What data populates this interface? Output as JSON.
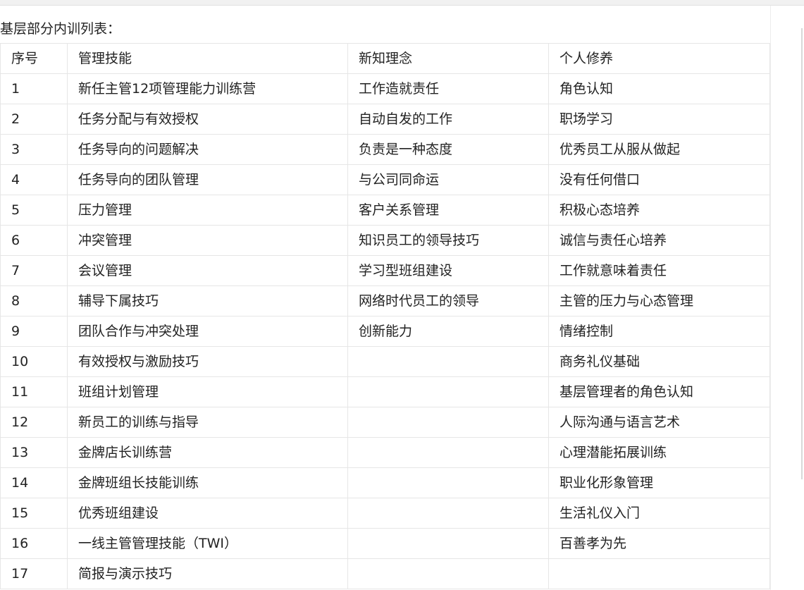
{
  "page_title": "基层部分内训列表：",
  "headers": [
    "序号",
    "管理技能",
    "新知理念",
    "个人修养"
  ],
  "rows": [
    [
      "1",
      "新任主管12项管理能力训练营",
      "工作造就责任",
      "角色认知"
    ],
    [
      "2",
      "任务分配与有效授权",
      "自动自发的工作",
      "职场学习"
    ],
    [
      "3",
      "任务导向的问题解决",
      "负责是一种态度",
      "优秀员工从服从做起"
    ],
    [
      "4",
      "任务导向的团队管理",
      "与公司同命运",
      "没有任何借口"
    ],
    [
      "5",
      "压力管理",
      "客户关系管理",
      "积极心态培养"
    ],
    [
      "6",
      "冲突管理",
      "知识员工的领导技巧",
      "诚信与责任心培养"
    ],
    [
      "7",
      "会议管理",
      "学习型班组建设",
      "工作就意味着责任"
    ],
    [
      "8",
      "辅导下属技巧",
      "网络时代员工的领导",
      "主管的压力与心态管理"
    ],
    [
      "9",
      "团队合作与冲突处理",
      "创新能力",
      "情绪控制"
    ],
    [
      "10",
      "有效授权与激励技巧",
      "",
      "商务礼仪基础"
    ],
    [
      "11",
      "班组计划管理",
      "",
      "基层管理者的角色认知"
    ],
    [
      "12",
      "新员工的训练与指导",
      "",
      "人际沟通与语言艺术"
    ],
    [
      "13",
      "金牌店长训练营",
      "",
      "心理潜能拓展训练"
    ],
    [
      "14",
      "金牌班组长技能训练",
      "",
      "职业化形象管理"
    ],
    [
      "15",
      "优秀班组建设",
      "",
      "生活礼仪入门"
    ],
    [
      "16",
      "一线主管管理技能（TWI）",
      "",
      "百善孝为先"
    ],
    [
      "17",
      "简报与演示技巧",
      "",
      ""
    ]
  ]
}
